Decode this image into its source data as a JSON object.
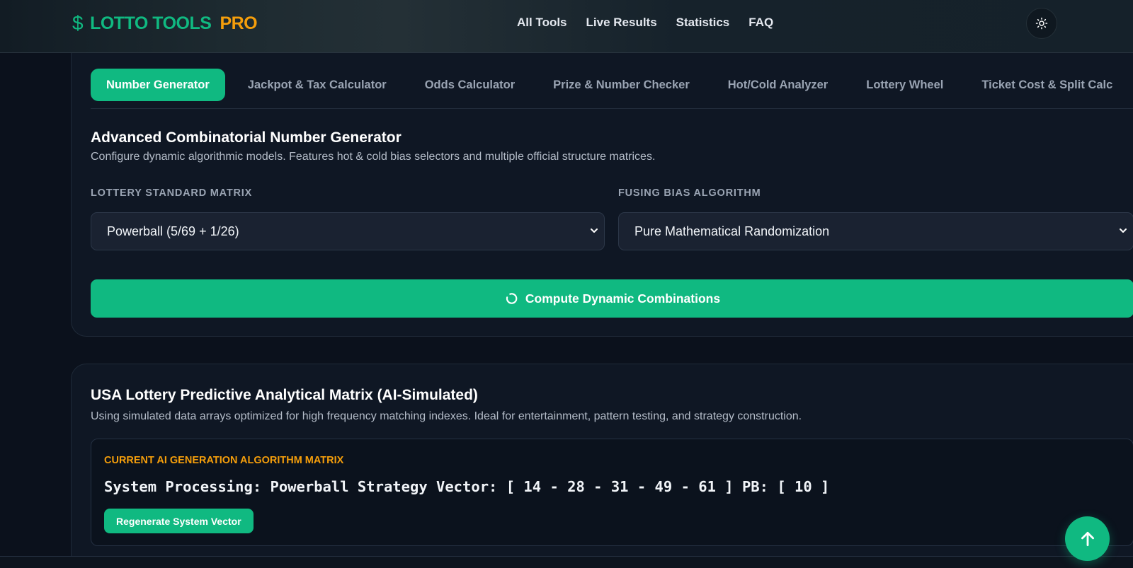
{
  "header": {
    "logo_symbol": "$",
    "logo_brand": "LOTTO TOOLS",
    "logo_pro": "PRO",
    "nav": [
      "All Tools",
      "Live Results",
      "Statistics",
      "FAQ"
    ],
    "theme_icon": "sun-icon"
  },
  "tabs": [
    {
      "label": "Number Generator",
      "active": true
    },
    {
      "label": "Jackpot & Tax Calculator",
      "active": false
    },
    {
      "label": "Odds Calculator",
      "active": false
    },
    {
      "label": "Prize & Number Checker",
      "active": false
    },
    {
      "label": "Hot/Cold Analyzer",
      "active": false
    },
    {
      "label": "Lottery Wheel",
      "active": false
    },
    {
      "label": "Ticket Cost & Split Calc",
      "active": false
    }
  ],
  "generator": {
    "title": "Advanced Combinatorial Number Generator",
    "description": "Configure dynamic algorithmic models. Features hot & cold bias selectors and multiple official structure matrices.",
    "matrix_label": "LOTTERY STANDARD MATRIX",
    "matrix_value": "Powerball (5/69 + 1/26)",
    "bias_label": "FUSING BIAS ALGORITHM",
    "bias_value": "Pure Mathematical Randomization",
    "compute_label": "Compute Dynamic Combinations",
    "compute_icon": "spinner-icon"
  },
  "predictive": {
    "title": "USA Lottery Predictive Analytical Matrix (AI-Simulated)",
    "description": "Using simulated data arrays optimized for high frequency matching indexes. Ideal for entertainment, pattern testing, and strategy construction.",
    "box_label": "CURRENT AI GENERATION ALGORITHM MATRIX",
    "vector_text": "System Processing: Powerball Strategy Vector: [ 14 - 28 - 31 - 49 - 61 ] PB: [ 10 ]",
    "regen_label": "Regenerate System Vector"
  },
  "colors": {
    "accent": "#10b981",
    "pro": "#f59e0b",
    "background": "#0b111c"
  }
}
